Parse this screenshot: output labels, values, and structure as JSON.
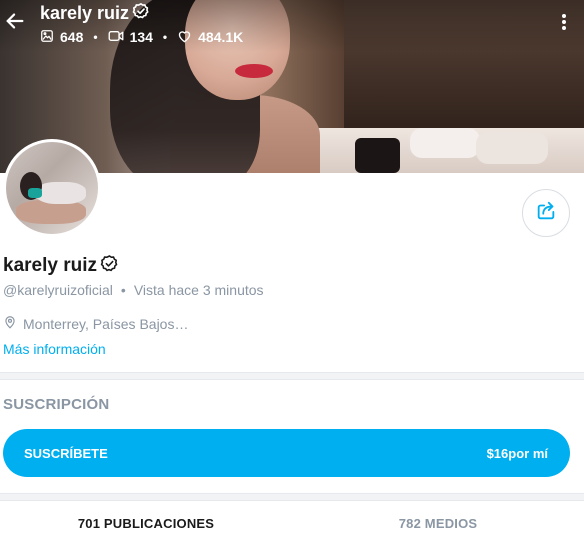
{
  "header": {
    "name": "karely ruiz",
    "stats": {
      "photos": "648",
      "videos": "134",
      "likes": "484.1K"
    }
  },
  "profile": {
    "name": "karely ruiz",
    "username": "@karelyruizoficial",
    "last_seen": "Vista hace 3 minutos",
    "location": "Monterrey, Países Bajos…",
    "more_info": "Más información"
  },
  "subscription": {
    "title": "SUSCRIPCIÓN",
    "button_label": "SUSCRÍBETE",
    "price": "$16por mí"
  },
  "tabs": [
    {
      "label": "701 PUBLICACIONES"
    },
    {
      "label": "782 MEDIOS"
    }
  ],
  "colors": {
    "accent": "#00aff0",
    "muted": "#8a96a3"
  }
}
